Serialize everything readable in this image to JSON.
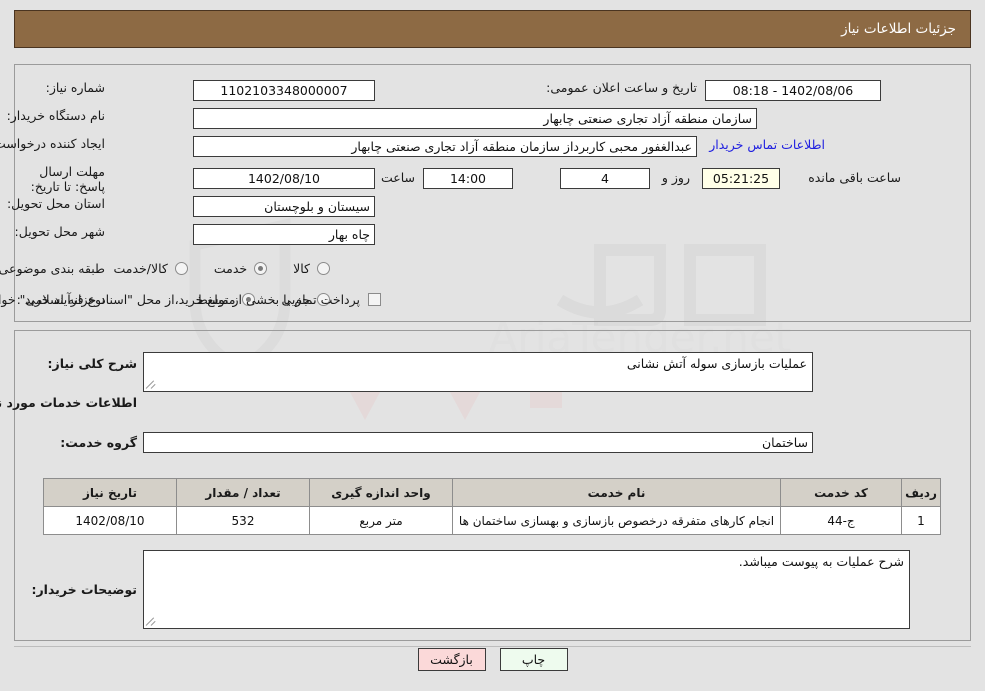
{
  "header": {
    "title": "جزئیات اطلاعات نیاز"
  },
  "top_panel": {
    "need_number": {
      "label": "شماره نیاز:",
      "value": "1102103348000007"
    },
    "announce_datetime": {
      "label": "تاریخ و ساعت اعلان عمومی:",
      "value": "1402/08/06 - 08:18"
    },
    "buyer_org": {
      "label": "نام دستگاه خریدار:",
      "value": "سازمان منطقه آزاد تجاری صنعتی چابهار"
    },
    "request_creator": {
      "label": "ایجاد کننده درخواست:",
      "value": "عبدالغفور محبی کاربرداز سازمان منطقه آزاد تجاری صنعتی چابهار"
    },
    "contact_link": "اطلاعات تماس خریدار",
    "deadline": {
      "label": "مهلت ارسال پاسخ: تا تاریخ:",
      "date": "1402/08/10",
      "hour_label": "ساعت",
      "time": "14:00",
      "days": "4",
      "days_label": "روز و",
      "countdown": "05:21:25",
      "countdown_label": "ساعت باقی مانده"
    },
    "province": {
      "label": "استان محل تحویل:",
      "value": "سیستان و بلوچستان"
    },
    "city": {
      "label": "شهر محل تحویل:",
      "value": "چاه بهار"
    },
    "category": {
      "label": "طبقه بندی موضوعی:",
      "options": [
        {
          "label": "کالا",
          "selected": false
        },
        {
          "label": "خدمت",
          "selected": true
        },
        {
          "label": "کالا/خدمت",
          "selected": false
        }
      ]
    },
    "purchase_process": {
      "label": "نوع فرآیند خرید :",
      "options": [
        {
          "label": "جزیی",
          "selected": false
        },
        {
          "label": "متوسط",
          "selected": true
        }
      ],
      "checkbox": {
        "checked": false,
        "label": "پرداخت تمام یا بخشی از مبلغ خرید،از محل \"اسناد خزانه اسلامی\" خواهد بود."
      }
    }
  },
  "bottom_panel": {
    "general_desc": {
      "label": "شرح کلی نیاز:",
      "value": "عملیات بازسازی سوله آتش نشانی"
    },
    "services_heading": "اطلاعات خدمات مورد نیاز",
    "service_group": {
      "label": "گروه خدمت:",
      "value": "ساختمان"
    },
    "table": {
      "columns": [
        "ردیف",
        "کد خدمت",
        "نام خدمت",
        "واحد اندازه گیری",
        "تعداد / مقدار",
        "تاریخ نیاز"
      ],
      "rows": [
        {
          "index": "1",
          "code": "ج-44",
          "name": "انجام کارهای متفرقه درخصوص بازسازی و بهسازی ساختمان ها",
          "unit": "متر مربع",
          "qty": "532",
          "date": "1402/08/10"
        }
      ]
    },
    "buyer_notes": {
      "label": "توضیحات خریدار:",
      "value": "شرح عملیات به پیوست میباشد."
    }
  },
  "buttons": {
    "print": "چاپ",
    "back": "بازگشت"
  },
  "watermark": {
    "text": "AriaTender.net"
  },
  "colors": {
    "header_bg": "#8d6a44",
    "page_bg": "#e3e3e3",
    "link": "#2020e0",
    "countdown_bg": "#ffffe8",
    "print_btn_bg": "#eefbee",
    "back_btn_bg": "#fbd9d9",
    "table_header_bg": "#d4d0c8"
  }
}
